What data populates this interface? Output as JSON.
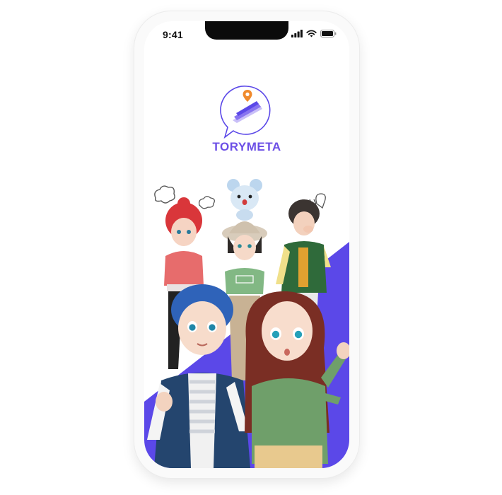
{
  "status_bar": {
    "time": "9:41"
  },
  "app": {
    "name": "TORYMETA"
  },
  "colors": {
    "accent": "#6c4fe6",
    "panel": "#5b48e8"
  },
  "icons": [
    "signal-icon",
    "wifi-icon",
    "battery-icon",
    "chat-bubble-logo-icon",
    "location-pin-icon"
  ],
  "illustration": {
    "characters": 6,
    "doodles": [
      "thought-bubble",
      "thought-bubble",
      "sweat-marks",
      "speech-bubble"
    ]
  }
}
